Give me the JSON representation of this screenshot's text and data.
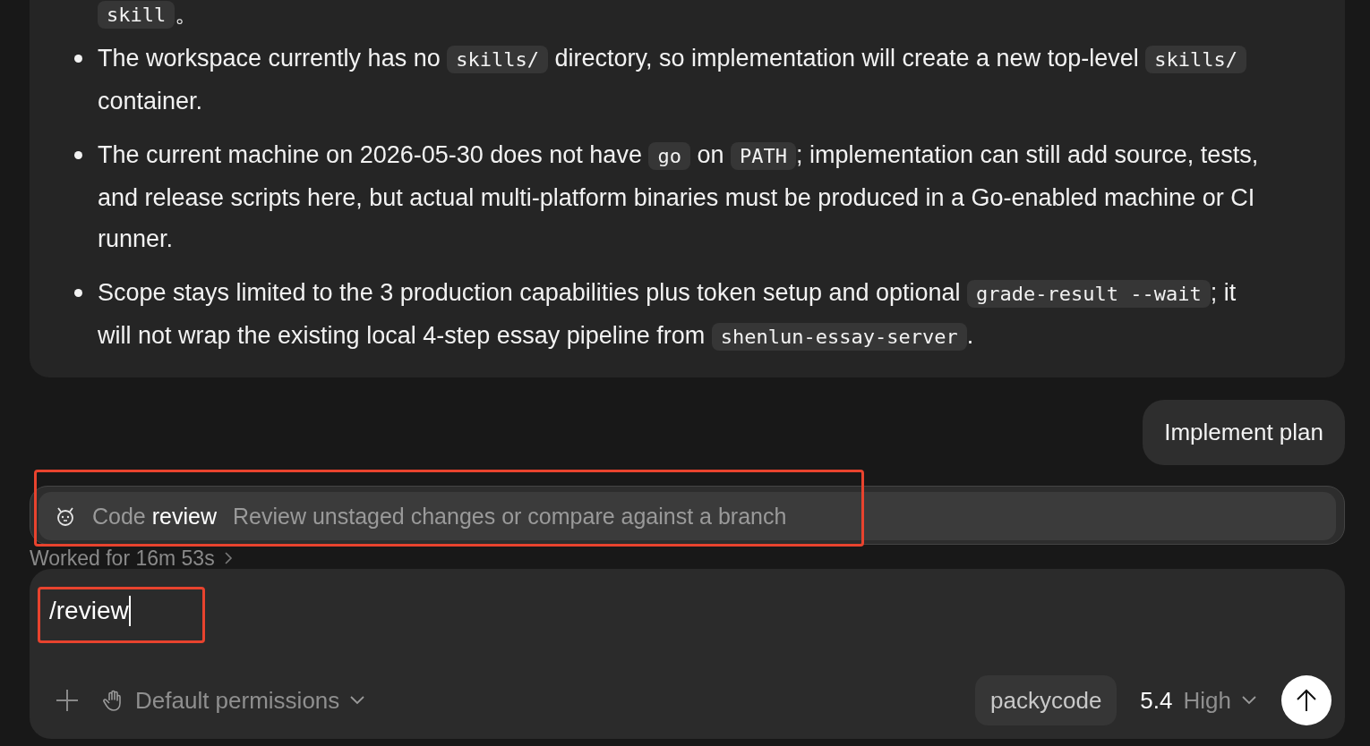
{
  "plan_card": {
    "continued_line": [
      {
        "kind": "code",
        "text": "skill"
      },
      {
        "kind": "text",
        "text": "。"
      }
    ],
    "bullets": [
      [
        {
          "kind": "text",
          "text": "The workspace currently has no "
        },
        {
          "kind": "code",
          "text": "skills/"
        },
        {
          "kind": "text",
          "text": " directory, so implementation will create a new top-level "
        },
        {
          "kind": "code",
          "text": "skills/"
        },
        {
          "kind": "text",
          "text": " container."
        }
      ],
      [
        {
          "kind": "text",
          "text": "The current machine on 2026-05-30 does not have "
        },
        {
          "kind": "code",
          "text": "go"
        },
        {
          "kind": "text",
          "text": " on "
        },
        {
          "kind": "code",
          "text": "PATH"
        },
        {
          "kind": "text",
          "text": "; implementation can still add source, tests, and release scripts here, but actual multi-platform binaries must be produced in a Go-enabled machine or CI runner."
        }
      ],
      [
        {
          "kind": "text",
          "text": "Scope stays limited to the 3 production capabilities plus token setup and optional "
        },
        {
          "kind": "code",
          "text": "grade-result --wait"
        },
        {
          "kind": "text",
          "text": "; it will not wrap the existing local 4-step essay pipeline from "
        },
        {
          "kind": "code",
          "text": "shenlun-essay-server"
        },
        {
          "kind": "text",
          "text": "."
        }
      ]
    ]
  },
  "user_message": "Implement plan",
  "worked_for": "Worked for 16m 53s",
  "command_popup": {
    "items": [
      {
        "prefix": "Code",
        "name": "review",
        "description": "Review unstaged changes or compare against a branch",
        "selected": true
      }
    ]
  },
  "composer": {
    "value": "/review",
    "permissions": "Default permissions",
    "provider": "packycode",
    "model": "5.4",
    "effort": "High"
  },
  "annotations": [
    {
      "kind": "frame"
    },
    {
      "kind": "frame"
    }
  ]
}
